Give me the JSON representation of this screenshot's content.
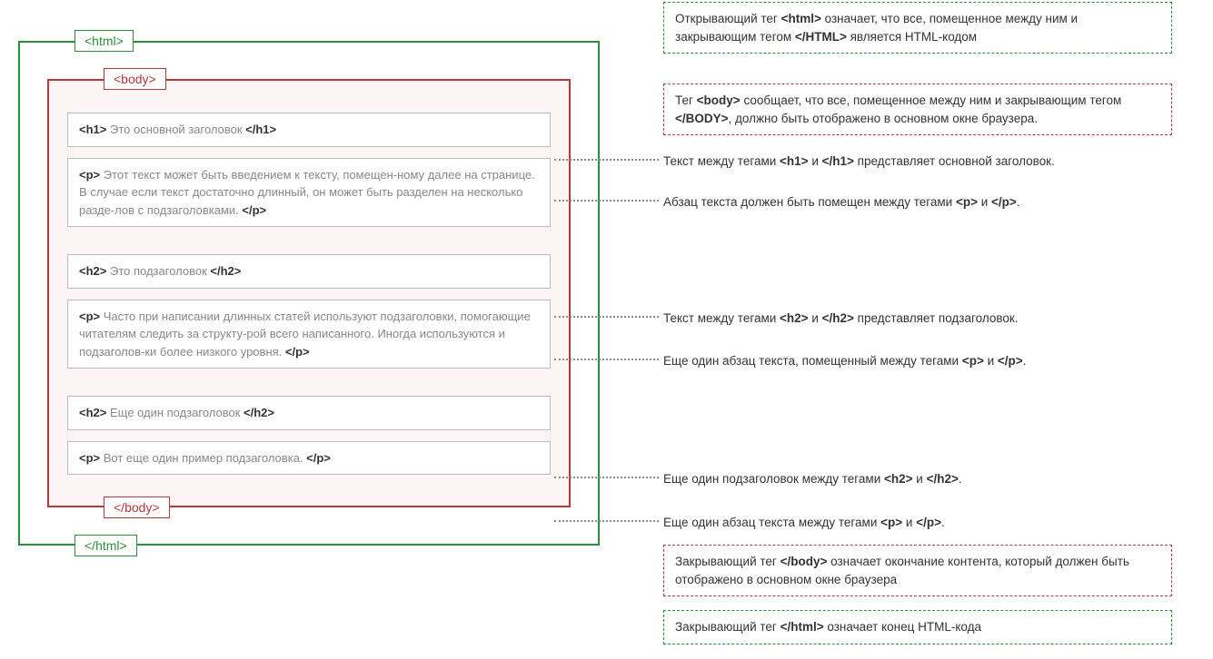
{
  "tags": {
    "html_open": "<html>",
    "html_close": "</html>",
    "body_open": "<body>",
    "body_close": "</body>"
  },
  "blocks": {
    "h1": {
      "open": "<h1>",
      "text": " Это  основной  заголовок ",
      "close": "</h1>"
    },
    "p1": {
      "open": "<p>",
      "text": " Этот  текст  может  быть  введением к  тексту, помещен-ному  далее  на  странице.  В  случае  если  текст  достаточно длинный,  он  может  быть  разделен  на  несколько  разде-лов с  подзаголовками. ",
      "close": "</p>"
    },
    "h2a": {
      "open": "<h2>",
      "text": " Это  подзаголовок ",
      "close": "</h2>"
    },
    "p2": {
      "open": "<p>",
      "text": " Часто  при  написании  длинных  статей  используют подзаголовки,  помогающие  читателям  следить  за структу-рой  всего  написанного.  Иногда  используются и подзаголов-ки более  низкого  уровня. ",
      "close": "</p>"
    },
    "h2b": {
      "open": "<h2>",
      "text": " Еще  один  подзаголовок ",
      "close": "</h2>"
    },
    "p3": {
      "open": "<p>",
      "text": " Вот еще один пример  подзаголовка. ",
      "close": "</p>"
    }
  },
  "annotations": {
    "html_open": {
      "pre": "Открывающий тег ",
      "tag1": "<html>",
      "mid": " означает, что все, помещенное между ним и закрывающим тегом ",
      "tag2": "</HTML>",
      "post": " является HTML-кодом"
    },
    "body_open": {
      "pre": "Тег ",
      "tag1": "<body>",
      "mid": " сообщает, что все, помещенное между ним и закрывающим тегом ",
      "tag2": "</BODY>",
      "post": ", должно быть отображено в основном окне браузера."
    },
    "h1": {
      "pre": "Текст между тегами ",
      "tag1": "<h1>",
      "mid": " и ",
      "tag2": "</h1>",
      "post": " представляет основной заголовок."
    },
    "p1": {
      "pre": "Абзац текста должен быть помещен между тегами ",
      "tag1": "<p>",
      "mid": " и ",
      "tag2": "</p>",
      "post": "."
    },
    "h2a": {
      "pre": "Текст между тегами ",
      "tag1": "<h2>",
      "mid": " и ",
      "tag2": "</h2>",
      "post": " представляет подзаголовок."
    },
    "p2": {
      "pre": "Еще один абзац текста, помещенный между тегами ",
      "tag1": "<p>",
      "mid": " и ",
      "tag2": "</p>",
      "post": "."
    },
    "h2b": {
      "pre": "Еще один подзаголовок между тегами ",
      "tag1": "<h2>",
      "mid": " и ",
      "tag2": "</h2>",
      "post": "."
    },
    "p3": {
      "pre": "Еще один абзац текста между тегами ",
      "tag1": "<p>",
      "mid": " и ",
      "tag2": "</p>",
      "post": "."
    },
    "body_close": {
      "pre": "Закрывающий тег ",
      "tag1": "</body>",
      "mid": " означает окончание контента, который должен быть отображено в основном окне браузера",
      "tag2": "",
      "post": ""
    },
    "html_close": {
      "pre": "Закрывающий тег ",
      "tag1": "</html>",
      "mid": " означает конец HTML-кода",
      "tag2": "",
      "post": ""
    }
  }
}
